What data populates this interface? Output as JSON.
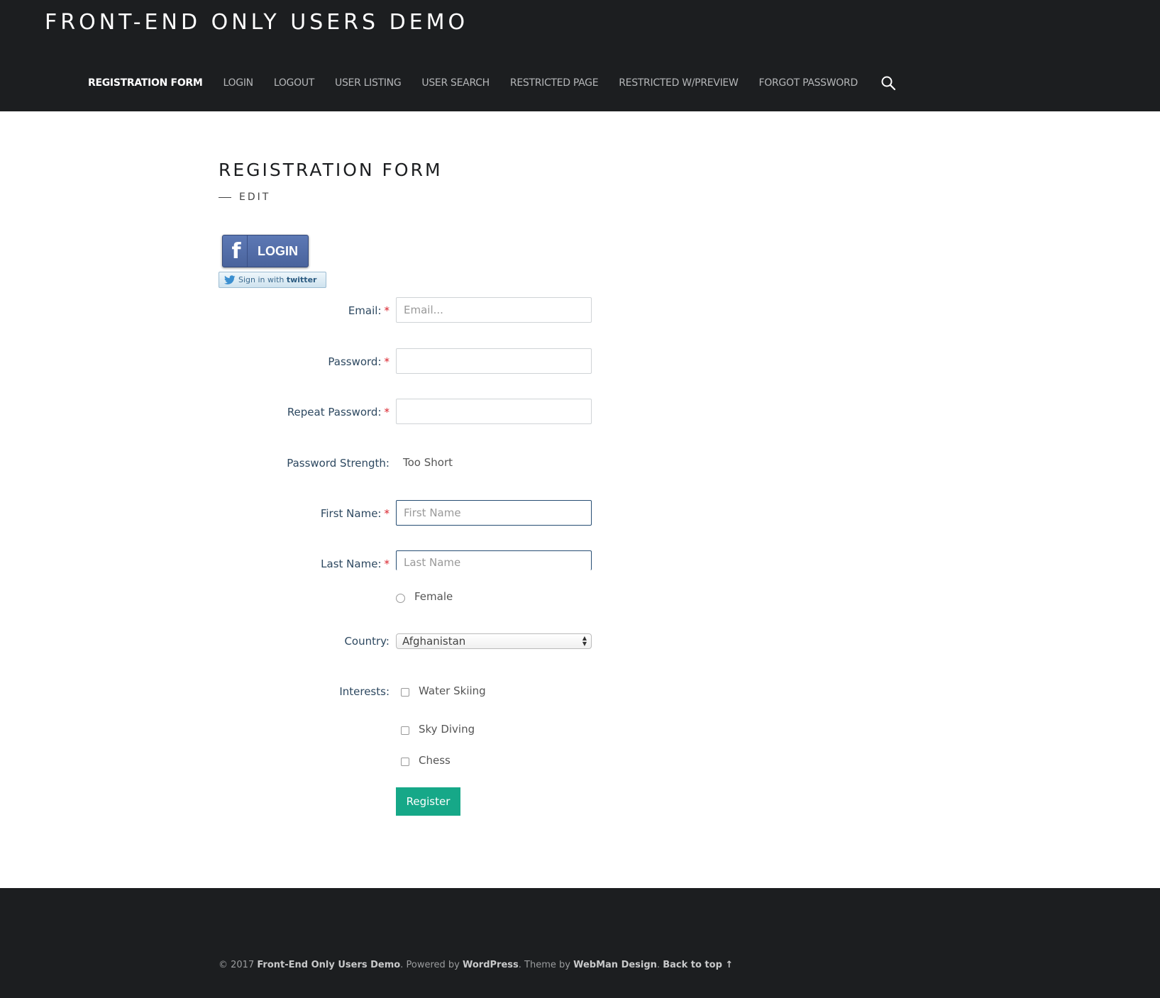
{
  "site": {
    "title": "FRONT-END ONLY USERS DEMO"
  },
  "nav": {
    "items": [
      {
        "label": "REGISTRATION FORM",
        "active": true
      },
      {
        "label": "LOGIN"
      },
      {
        "label": "LOGOUT"
      },
      {
        "label": "USER LISTING"
      },
      {
        "label": "USER SEARCH"
      },
      {
        "label": "RESTRICTED PAGE"
      },
      {
        "label": "RESTRICTED W/PREVIEW"
      },
      {
        "label": "FORGOT PASSWORD"
      }
    ],
    "search_icon": "search-icon"
  },
  "page": {
    "title": "REGISTRATION FORM",
    "edit_link": "EDIT"
  },
  "social": {
    "facebook_label": "LOGIN",
    "facebook_icon": "facebook-f-icon",
    "twitter_prefix": "Sign in with",
    "twitter_brand": "twitter",
    "twitter_icon": "twitter-bird-icon"
  },
  "form": {
    "email": {
      "label": "Email:",
      "placeholder": "Email..."
    },
    "password": {
      "label": "Password:",
      "value": ""
    },
    "repeat_password": {
      "label": "Repeat Password:",
      "value": ""
    },
    "password_strength": {
      "label": "Password Strength:",
      "value": "Too Short"
    },
    "first_name": {
      "label": "First Name:",
      "placeholder": "First Name"
    },
    "last_name": {
      "label": "Last Name:",
      "placeholder": "Last Name"
    },
    "required_mark": "*",
    "gender_option": "Female",
    "country": {
      "label": "Country:",
      "selected": "Afghanistan"
    },
    "interests": {
      "label": "Interests:",
      "options": [
        "Water Skiing",
        "Sky Diving",
        "Chess"
      ]
    },
    "submit_label": "Register"
  },
  "footer": {
    "copyright": "© 2017",
    "site_link": "Front-End Only Users Demo",
    "powered_by": ". Powered by",
    "wp_link": "WordPress",
    "theme_by": ". Theme by",
    "theme_link": "WebMan Design",
    "back_to_top": "Back to top ↑"
  },
  "colors": {
    "header_bg": "#1c1e20",
    "register_button": "#16a888",
    "required_star": "#d9232d",
    "facebook_blue": "#4a639c"
  }
}
